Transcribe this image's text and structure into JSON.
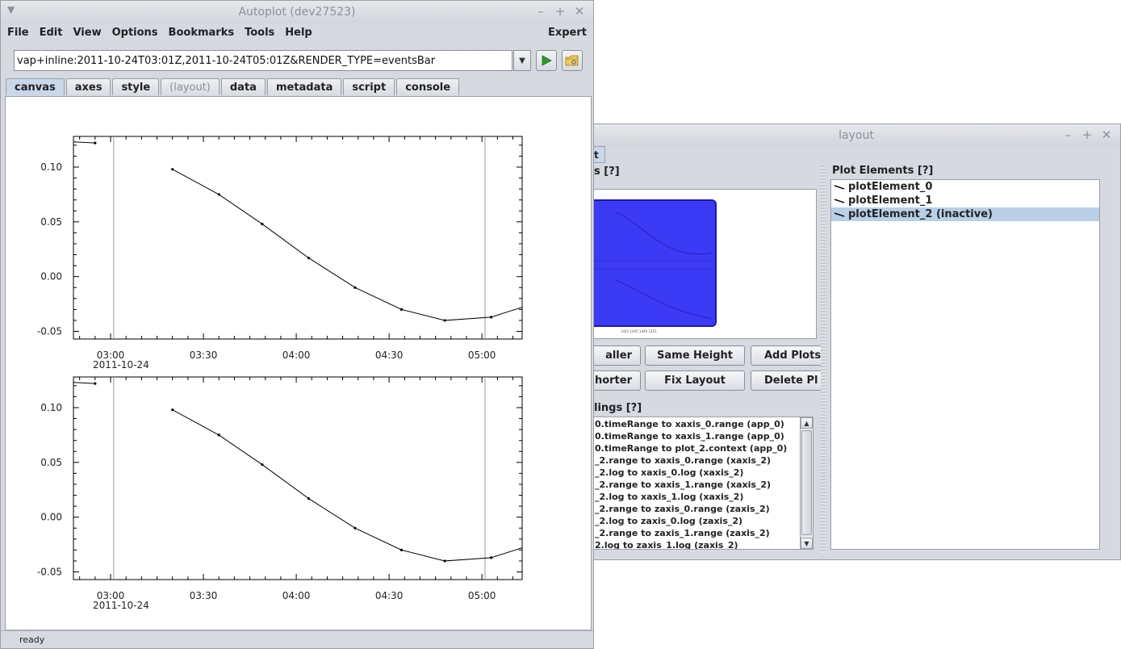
{
  "main_window": {
    "title": "Autoplot (dev27523)",
    "menu": [
      "File",
      "Edit",
      "View",
      "Options",
      "Bookmarks",
      "Tools",
      "Help"
    ],
    "menu_right": "Expert",
    "uri_value": "vap+inline:2011-10-24T03:01Z,2011-10-24T05:01Z&RENDER_TYPE=eventsBar",
    "tabs": [
      {
        "label": "canvas",
        "state": "active"
      },
      {
        "label": "axes",
        "state": "normal"
      },
      {
        "label": "style",
        "state": "normal"
      },
      {
        "label": "(layout)",
        "state": "disabled"
      },
      {
        "label": "data",
        "state": "normal"
      },
      {
        "label": "metadata",
        "state": "normal"
      },
      {
        "label": "script",
        "state": "normal"
      },
      {
        "label": "console",
        "state": "normal"
      }
    ],
    "status": "ready",
    "icons": {
      "run": "play-icon",
      "open": "folder-icon",
      "dropdown": "chevron-down-icon"
    },
    "colors": {
      "run_green": "#2a9d2a",
      "active_tab": "#c8d8ea"
    }
  },
  "chart_data": [
    {
      "type": "line",
      "title": "",
      "xlabel": "",
      "ylabel": "",
      "x_ticks": [
        "03:00",
        "03:30",
        "04:00",
        "04:30",
        "05:00"
      ],
      "x_tick_date": "2011-10-24",
      "y_ticks": [
        "0.10",
        "0.05",
        "0.00",
        "-0.05"
      ],
      "ylim": [
        -0.057,
        0.128
      ],
      "xlim": [
        "02:48",
        "05:13"
      ],
      "vertical_lines": [
        "03:01",
        "05:01"
      ],
      "series": [
        {
          "x": [
            "02:48",
            "02:55"
          ],
          "y": [
            0.123,
            0.122
          ]
        },
        {
          "x": [
            "03:20",
            "03:35",
            "03:49",
            "04:04",
            "04:19",
            "04:34",
            "04:48",
            "05:03",
            "05:13"
          ],
          "y": [
            0.098,
            0.075,
            0.048,
            0.017,
            -0.01,
            -0.03,
            -0.04,
            -0.037,
            -0.028
          ]
        }
      ]
    },
    {
      "type": "line",
      "title": "",
      "xlabel": "",
      "ylabel": "",
      "x_ticks": [
        "03:00",
        "03:30",
        "04:00",
        "04:30",
        "05:00"
      ],
      "x_tick_date": "2011-10-24",
      "y_ticks": [
        "0.10",
        "0.05",
        "0.00",
        "-0.05"
      ],
      "ylim": [
        -0.057,
        0.128
      ],
      "xlim": [
        "02:48",
        "05:13"
      ],
      "vertical_lines": [
        "03:01",
        "05:01"
      ],
      "series": [
        {
          "x": [
            "02:48",
            "02:55"
          ],
          "y": [
            0.123,
            0.122
          ]
        },
        {
          "x": [
            "03:20",
            "03:35",
            "03:49",
            "04:04",
            "04:19",
            "04:34",
            "04:48",
            "05:03",
            "05:13"
          ],
          "y": [
            0.098,
            0.075,
            0.048,
            0.017,
            -0.01,
            -0.03,
            -0.04,
            -0.037,
            -0.028
          ]
        }
      ]
    }
  ],
  "layout_window": {
    "title": "layout",
    "tab_fragment": "t",
    "canvas_group_label": "s [?]",
    "buttons": [
      {
        "label": "aller"
      },
      {
        "label": "Same Height"
      },
      {
        "label": "Add Plots"
      },
      {
        "label": "horter"
      },
      {
        "label": "Fix Layout"
      },
      {
        "label": "Delete Pl"
      }
    ],
    "bindings_label": "lings [?]",
    "bindings": [
      "0.timeRange to xaxis_0.range  (app_0)",
      "0.timeRange to xaxis_1.range  (app_0)",
      "0.timeRange to plot_2.context  (app_0)",
      "_2.range to xaxis_0.range  (xaxis_2)",
      "_2.log to xaxis_0.log  (xaxis_2)",
      "_2.range to xaxis_1.range  (xaxis_2)",
      "_2.log to xaxis_1.log  (xaxis_2)",
      "_2.range to zaxis_0.range  (zaxis_2)",
      "_2.log to zaxis_0.log  (zaxis_2)",
      "_2.range to zaxis_1.range  (zaxis_2)",
      "2.log to zaxis_1.log  (zaxis_2)"
    ],
    "plot_elements_label": "Plot Elements [?]",
    "plot_elements": [
      {
        "label": "plotElement_0",
        "selected": false
      },
      {
        "label": "plotElement_1",
        "selected": false
      },
      {
        "label": "plotElement_2 (inactive)",
        "selected": true
      }
    ],
    "colors": {
      "preview_blue": "#3b3bf5",
      "selection": "#b8cfe6"
    }
  }
}
